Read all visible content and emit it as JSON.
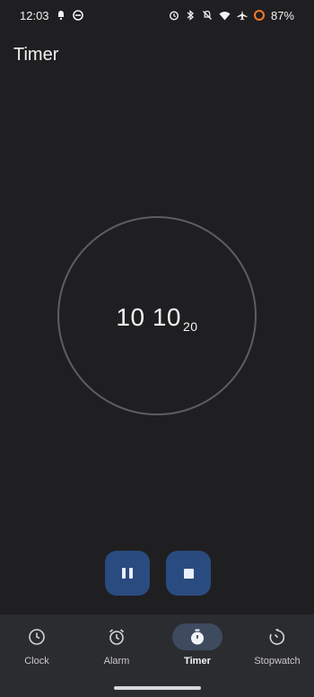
{
  "status_bar": {
    "time": "12:03",
    "battery_percent": "87%",
    "left_icons": [
      "notification-icon",
      "vpn-icon"
    ],
    "right_icons": [
      "alarm-icon",
      "bluetooth-icon",
      "mute-icon",
      "wifi-icon",
      "airplane-icon",
      "battery-saver-icon"
    ]
  },
  "header": {
    "title": "Timer"
  },
  "timer": {
    "display_main": "10 10",
    "display_seconds": "20"
  },
  "controls": {
    "pause_icon": "pause-icon",
    "stop_icon": "stop-icon",
    "accent_color": "#2a4b7f"
  },
  "bottom_nav": {
    "items": [
      {
        "label": "Clock",
        "icon": "clock-icon",
        "active": false
      },
      {
        "label": "Alarm",
        "icon": "alarm-icon",
        "active": false
      },
      {
        "label": "Timer",
        "icon": "timer-icon",
        "active": true
      },
      {
        "label": "Stopwatch",
        "icon": "stopwatch-icon",
        "active": false
      }
    ]
  }
}
